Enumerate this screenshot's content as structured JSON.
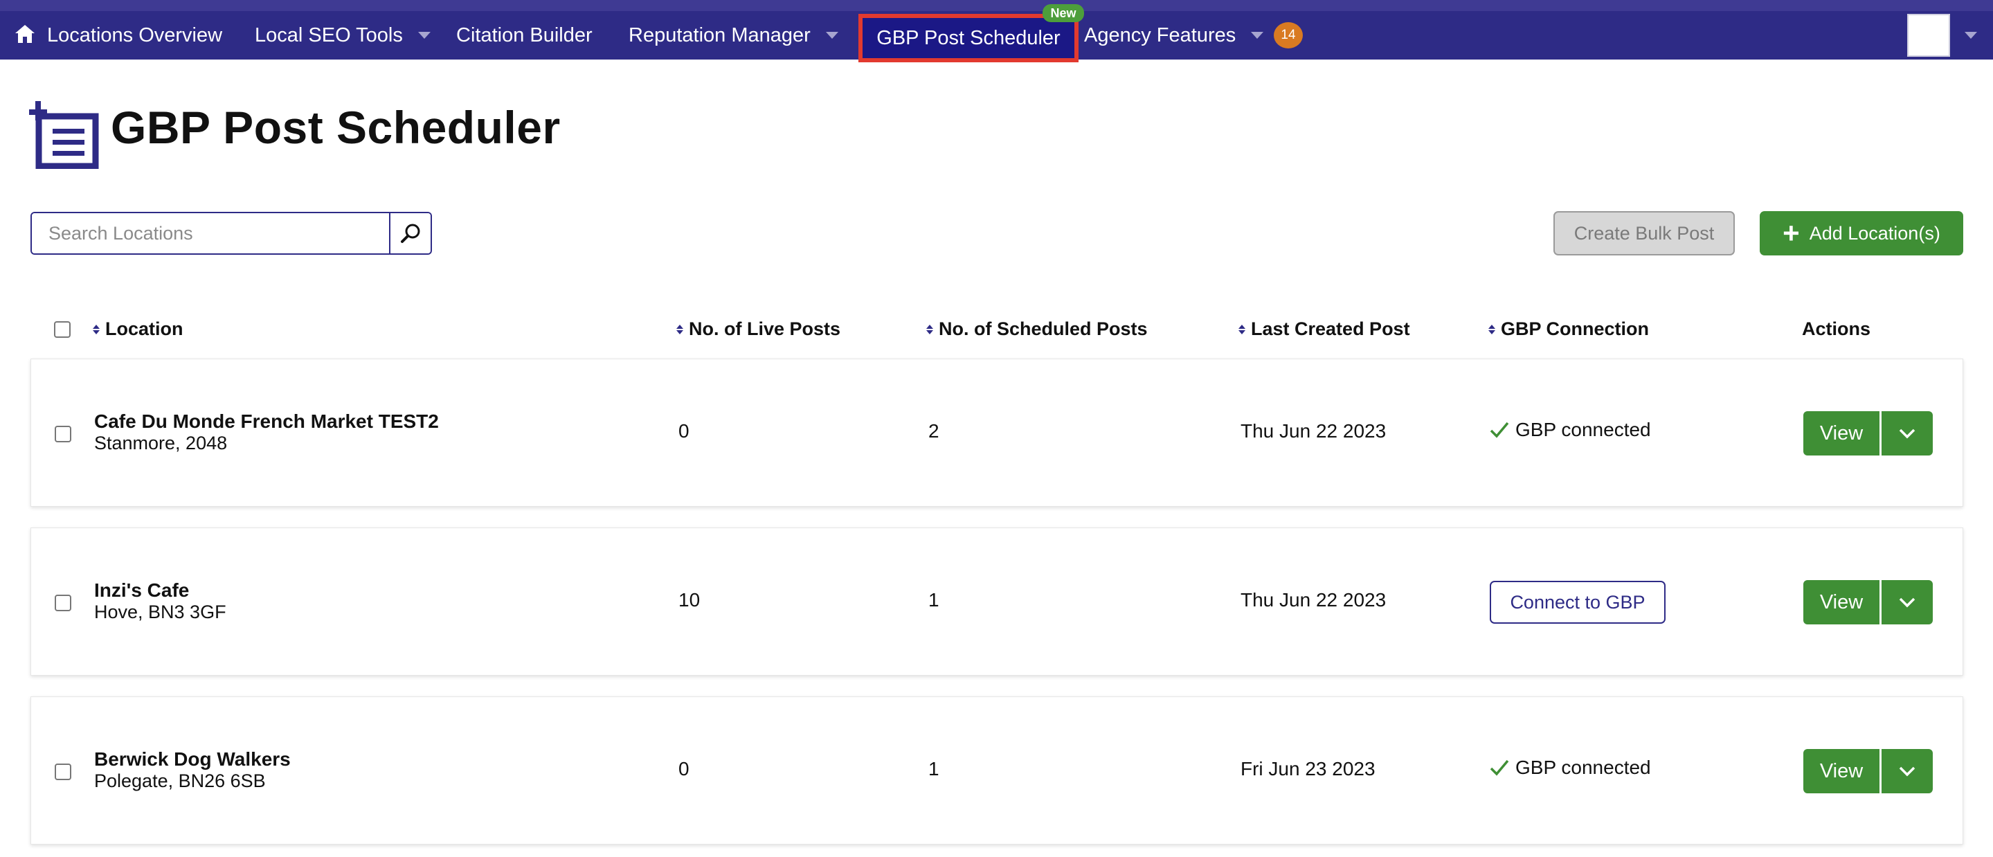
{
  "nav": {
    "items": [
      {
        "label": "Locations Overview",
        "icon": "home-icon"
      },
      {
        "label": "Local SEO Tools"
      },
      {
        "label": "Citation Builder"
      },
      {
        "label": "Reputation Manager"
      },
      {
        "label": "GBP Post Scheduler",
        "active": true
      },
      {
        "label": "Agency Features"
      }
    ],
    "new_badge": "New",
    "count_badge": "14"
  },
  "page": {
    "title": "GBP Post Scheduler",
    "search_placeholder": "Search Locations",
    "bulk_button": "Create Bulk Post",
    "add_button": "Add Location(s)"
  },
  "table": {
    "headers": {
      "location": "Location",
      "live": "No. of Live Posts",
      "scheduled": "No. of Scheduled Posts",
      "last": "Last Created Post",
      "gbp": "GBP Connection",
      "actions": "Actions"
    },
    "rows": [
      {
        "name": "Cafe Du Monde French Market TEST2",
        "address": "Stanmore, 2048",
        "live": "0",
        "scheduled": "2",
        "last": "Thu Jun 22 2023",
        "gbp": "GBP connected",
        "connected": true,
        "view": "View"
      },
      {
        "name": "Inzi's Cafe",
        "address": "Hove, BN3 3GF",
        "live": "10",
        "scheduled": "1",
        "last": "Thu Jun 22 2023",
        "gbp": "Connect to GBP",
        "connected": false,
        "view": "View"
      },
      {
        "name": "Berwick Dog Walkers",
        "address": "Polegate, BN26 6SB",
        "live": "0",
        "scheduled": "1",
        "last": "Fri Jun 23 2023",
        "gbp": "GBP connected",
        "connected": true,
        "view": "View"
      }
    ]
  },
  "colors": {
    "nav_bg": "#2e2b86",
    "active_tab": "#1b1886",
    "highlight": "#e23a2f",
    "primary_green": "#3f8f35",
    "badge_orange": "#d97a22"
  }
}
